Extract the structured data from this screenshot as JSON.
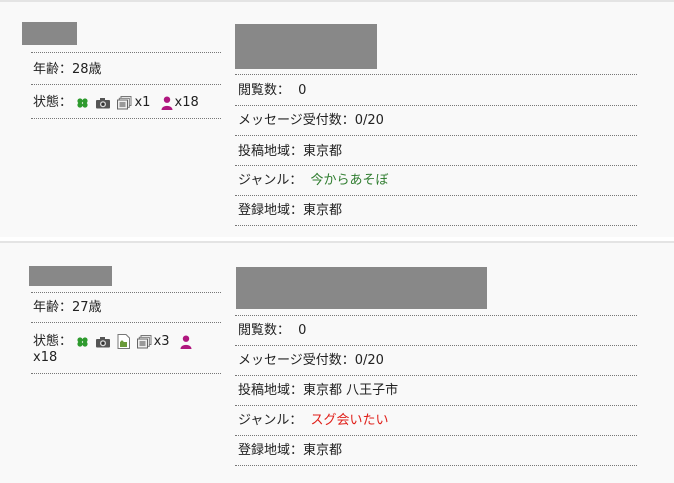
{
  "cards": [
    {
      "age_label": "年齢：28歳",
      "status_label": "状態：",
      "photos_count": "x1",
      "friends_count": "x18",
      "rows": [
        {
          "label": "閲覧数：",
          "value": "0"
        },
        {
          "label": "メッセージ受付数：0/20",
          "value": ""
        },
        {
          "label": "投稿地域：東京都",
          "value": ""
        },
        {
          "label": "ジャンル：",
          "value": "今からあそぼ"
        },
        {
          "label": "登録地域：東京都",
          "value": ""
        }
      ]
    },
    {
      "age_label": "年齢：27歳",
      "status_label": "状態：",
      "photos_count": "x3",
      "friends_count": "x18",
      "rows": [
        {
          "label": "閲覧数：",
          "value": "0"
        },
        {
          "label": "メッセージ受付数：0/20",
          "value": ""
        },
        {
          "label": "投稿地域：東京都 八王子市",
          "value": ""
        },
        {
          "label": "ジャンル：",
          "value": "スグ会いたい"
        },
        {
          "label": "登録地域：東京都",
          "value": ""
        }
      ]
    }
  ],
  "colors": {
    "genre_card1": "#2f7d2f",
    "genre_card2": "#e0201a",
    "redaction": "#888888",
    "clover_icon": "#2e9a2e",
    "person_icon": "#b0177f"
  },
  "icons": [
    "clover-icon",
    "camera-icon",
    "photos-icon",
    "person-icon",
    "document-icon"
  ]
}
